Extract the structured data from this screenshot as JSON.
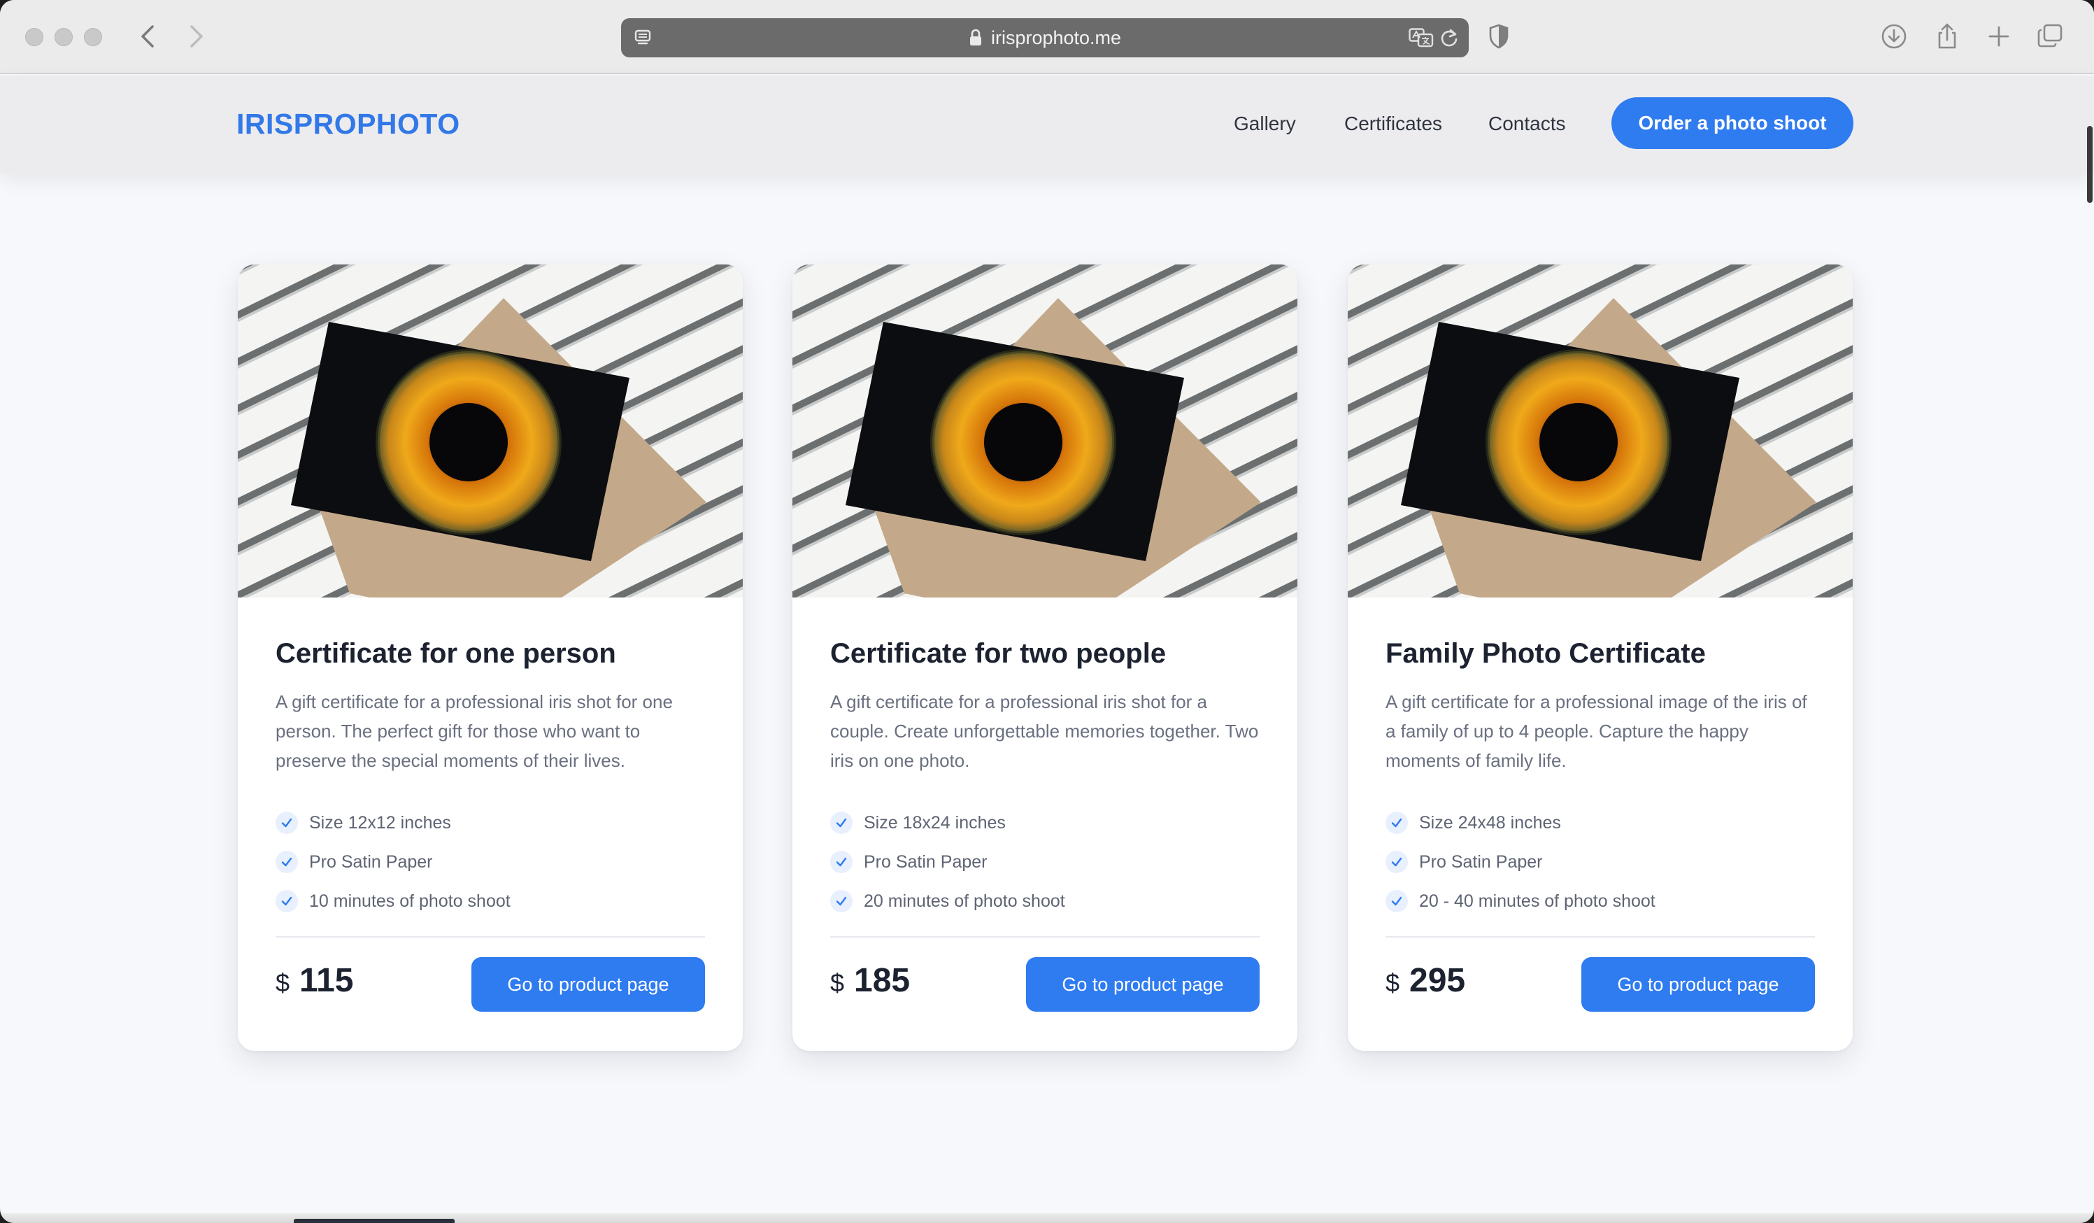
{
  "browser": {
    "url": "irisprophoto.me"
  },
  "site": {
    "logo": "IRISPROPHOTO",
    "nav": [
      {
        "label": "Gallery"
      },
      {
        "label": "Certificates"
      },
      {
        "label": "Contacts"
      }
    ],
    "cta_label": "Order a photo shoot",
    "accent_color": "#2f7bf0"
  },
  "cards": [
    {
      "title": "Certificate for one person",
      "description": "A gift certificate for a professional iris shot for one person. The perfect gift for those who want to preserve the special moments of their lives.",
      "features": [
        "Size 12x12 inches",
        "Pro Satin Paper",
        "10 minutes of photo shoot"
      ],
      "currency": "$",
      "price": "115",
      "button_label": "Go to product page"
    },
    {
      "title": "Certificate for two people",
      "description": "A gift certificate for a professional iris shot for a couple. Create unforgettable memories together. Two iris on one photo.",
      "features": [
        "Size 18x24 inches",
        "Pro Satin Paper",
        "20 minutes of photo shoot"
      ],
      "currency": "$",
      "price": "185",
      "button_label": "Go to product page"
    },
    {
      "title": "Family Photo Certificate",
      "description": "A gift certificate for a professional image of the iris of a family of up to 4 people. Capture the happy moments of family life.",
      "features": [
        "Size 24x48 inches",
        "Pro Satin Paper",
        "20 - 40 minutes of photo shoot"
      ],
      "currency": "$",
      "price": "295",
      "button_label": "Go to product page"
    }
  ]
}
